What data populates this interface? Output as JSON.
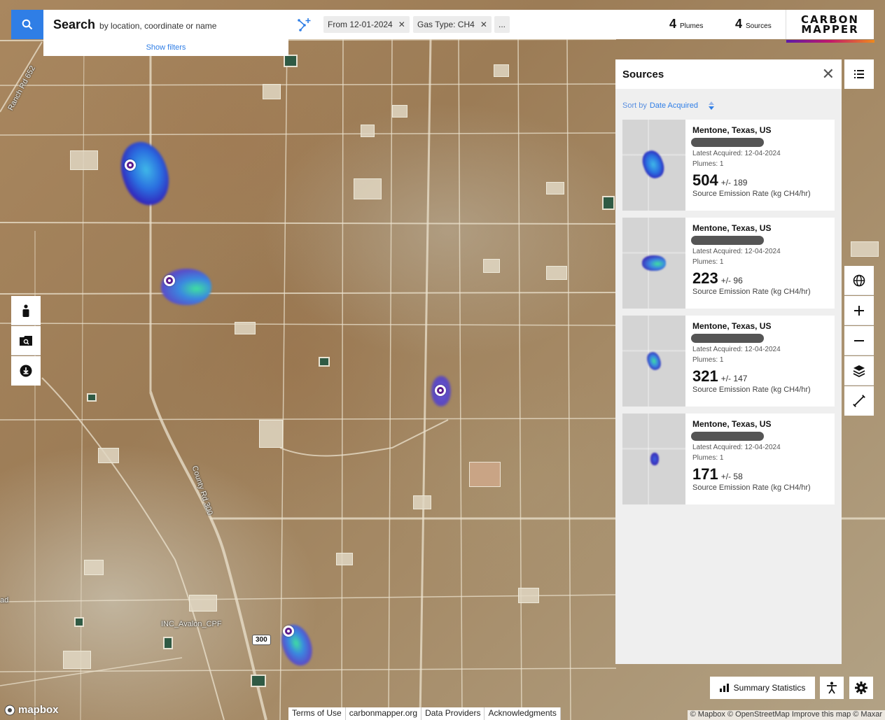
{
  "search": {
    "title": "Search",
    "hint": "by location, coordinate or name"
  },
  "filters": {
    "show_label": "Show filters",
    "chips": [
      {
        "label": "From 12-01-2024",
        "removable": true
      },
      {
        "label": "Gas Type: CH4",
        "removable": true
      },
      {
        "label": "...",
        "removable": false
      }
    ]
  },
  "counts": {
    "plumes_value": "4",
    "plumes_label": "Plumes",
    "sources_value": "4",
    "sources_label": "Sources"
  },
  "brand": {
    "line1": "CARBON",
    "line2": "MAPPER"
  },
  "panel": {
    "title": "Sources",
    "sort_prefix": "Sort by",
    "sort_field": "Date Acquired",
    "cards": [
      {
        "location": "Mentone, Texas, US",
        "latest_acquired": "Latest Acquired: 12-04-2024",
        "plumes": "Plumes: 1",
        "rate": "504",
        "uncertainty": "+/- 189",
        "unit": "Source Emission Rate (kg CH4/hr)"
      },
      {
        "location": "Mentone, Texas, US",
        "latest_acquired": "Latest Acquired: 12-04-2024",
        "plumes": "Plumes: 1",
        "rate": "223",
        "uncertainty": "+/- 96",
        "unit": "Source Emission Rate (kg CH4/hr)"
      },
      {
        "location": "Mentone, Texas, US",
        "latest_acquired": "Latest Acquired: 12-04-2024",
        "plumes": "Plumes: 1",
        "rate": "321",
        "uncertainty": "+/- 147",
        "unit": "Source Emission Rate (kg CH4/hr)"
      },
      {
        "location": "Mentone, Texas, US",
        "latest_acquired": "Latest Acquired: 12-04-2024",
        "plumes": "Plumes: 1",
        "rate": "171",
        "uncertainty": "+/- 58",
        "unit": "Source Emission Rate (kg CH4/hr)"
      }
    ]
  },
  "bottom": {
    "summary_label": "Summary Statistics"
  },
  "map_labels": {
    "road1": "Ranch Rd 652",
    "road2": "County Rd 300",
    "facility": "INC_Avalon_CPF",
    "shield": "300",
    "edge": "ad"
  },
  "footer": {
    "mapbox": "mapbox",
    "links": [
      "Terms of Use",
      "carbonmapper.org",
      "Data Providers",
      "Acknowledgments"
    ],
    "attribution": "© Mapbox © OpenStreetMap  Improve this map © Maxar"
  },
  "colors": {
    "accent": "#2f7ee6",
    "plume_purple": "#5b1a8c",
    "brand_gradient": [
      "#5c1aa8",
      "#c2186b",
      "#f08a1c"
    ]
  },
  "icons": {
    "search": "search-icon",
    "polygon": "draw-polygon-icon",
    "list": "list-icon",
    "globe": "globe-icon",
    "zoom_in": "plus-icon",
    "zoom_out": "minus-icon",
    "layers": "layers-icon",
    "measure": "ruler-icon",
    "person": "person-icon",
    "folder": "folder-search-icon",
    "download": "download-icon",
    "accessibility": "accessibility-icon",
    "settings": "gear-icon",
    "chart": "bar-chart-icon"
  }
}
